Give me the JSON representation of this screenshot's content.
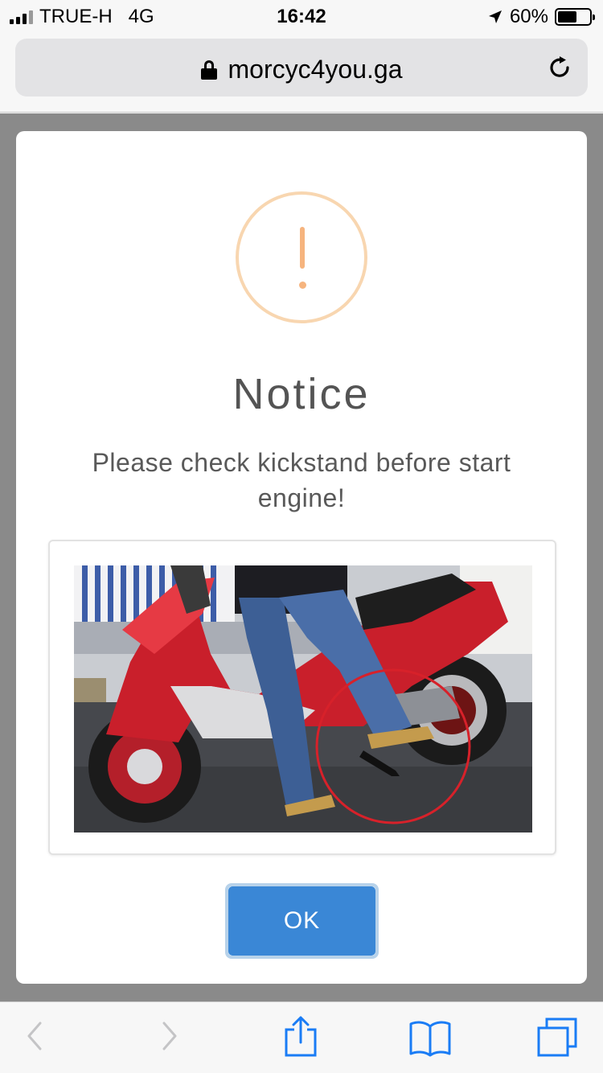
{
  "status_bar": {
    "carrier": "TRUE-H",
    "network": "4G",
    "time": "16:42",
    "battery": "60%",
    "battery_level": 0.6
  },
  "browser": {
    "url": "morcyc4you.ga"
  },
  "modal": {
    "title": "Notice",
    "text": "Please check kickstand before start engine!",
    "ok_label": "OK",
    "icon": "warning-exclamation-icon",
    "icon_color": "#f8bb86",
    "button_color": "#3085d6"
  },
  "toolbar": {
    "icons": [
      "back-icon",
      "forward-icon",
      "share-icon",
      "bookmarks-icon",
      "tabs-icon"
    ],
    "accent": "#1a7cf5"
  }
}
